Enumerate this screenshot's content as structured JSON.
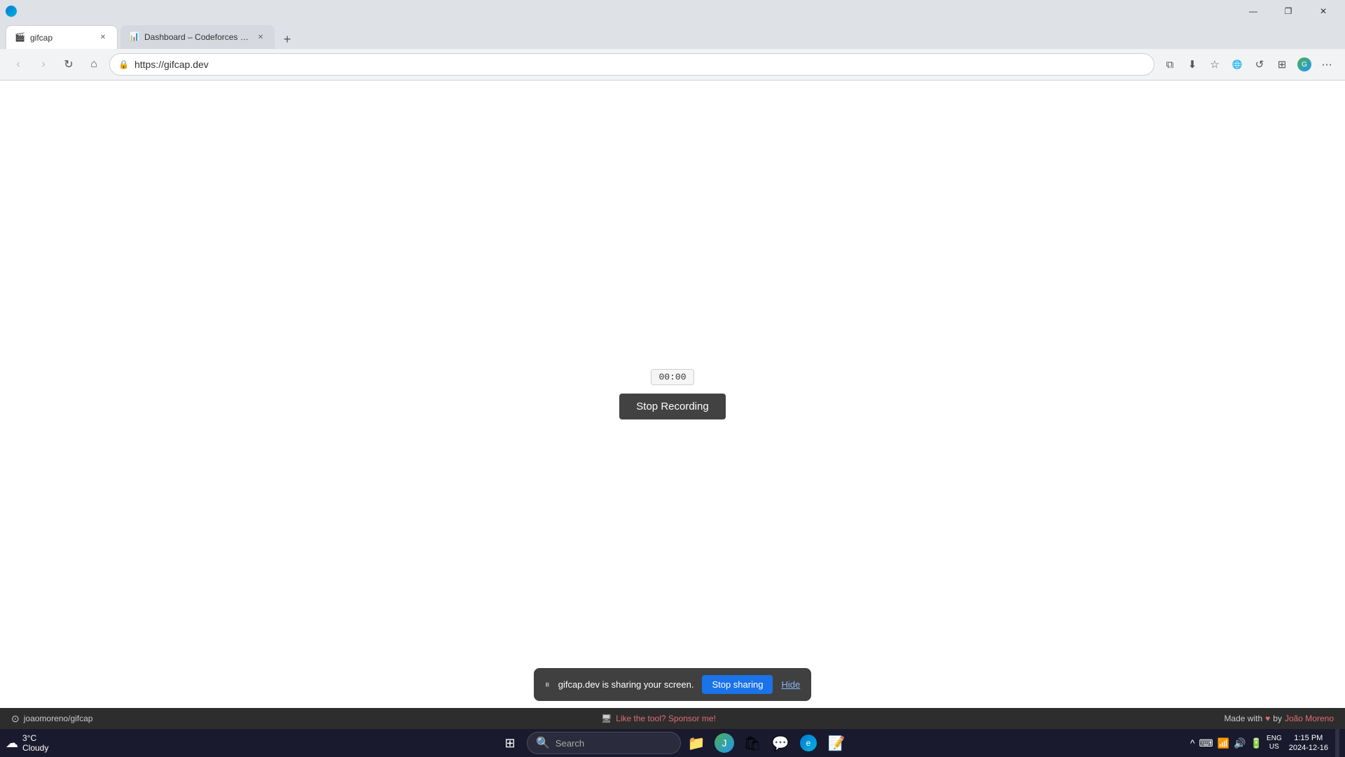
{
  "browser": {
    "title_bar": {
      "min_label": "—",
      "max_label": "❐",
      "close_label": "✕"
    },
    "tabs": [
      {
        "id": "tab-gifcap",
        "favicon": "🎬",
        "title": "gifcap",
        "active": true,
        "closeable": true
      },
      {
        "id": "tab-codeforces",
        "favicon": "📊",
        "title": "Dashboard – Codeforces Round...",
        "active": false,
        "closeable": true
      }
    ],
    "new_tab_label": "+",
    "address_bar": {
      "url": "https://gifcap.dev",
      "lock_icon": "🔒"
    },
    "nav": {
      "back": "‹",
      "forward": "›",
      "refresh": "↻",
      "home": "⌂"
    },
    "toolbar_icons": [
      "⧉",
      "⬇",
      "☆",
      "🌐",
      "🔄",
      "⧉",
      "≡"
    ]
  },
  "main": {
    "timer": "00:00",
    "stop_recording_label": "Stop Recording"
  },
  "sharing_bar": {
    "pause_icon": "⏸",
    "message": "gifcap.dev is sharing your screen.",
    "stop_sharing_label": "Stop sharing",
    "hide_label": "Hide"
  },
  "footer": {
    "github_icon": "⊙",
    "user_repo": "joaomoreno/gifcap",
    "sponsor_icon": "🖥",
    "sponsor_text": "Like the tool? Sponsor me!",
    "made_with": "Made with",
    "heart": "♥",
    "by": "by",
    "author": "João Moreno"
  },
  "taskbar": {
    "weather": {
      "icon": "☁",
      "temp": "3°C",
      "condition": "Cloudy"
    },
    "start_icon": "⊞",
    "search_placeholder": "Search",
    "search_icon": "🔍",
    "apps": [
      {
        "name": "file-explorer",
        "icon": "📁"
      },
      {
        "name": "browser",
        "icon": "🌐"
      },
      {
        "name": "store",
        "icon": "🛍"
      },
      {
        "name": "discord",
        "icon": "💬"
      },
      {
        "name": "edge",
        "icon": "🌐"
      },
      {
        "name": "vscode",
        "icon": "📝"
      }
    ],
    "system_tray": {
      "chevron": "^",
      "keyboard": "⌨",
      "network": "📶",
      "volume": "🔊",
      "battery": "🔋",
      "lang": "ENG\nUS"
    },
    "clock": {
      "time": "1:15 PM",
      "date": "2024-12-16"
    },
    "avatar_icon": "👤"
  }
}
